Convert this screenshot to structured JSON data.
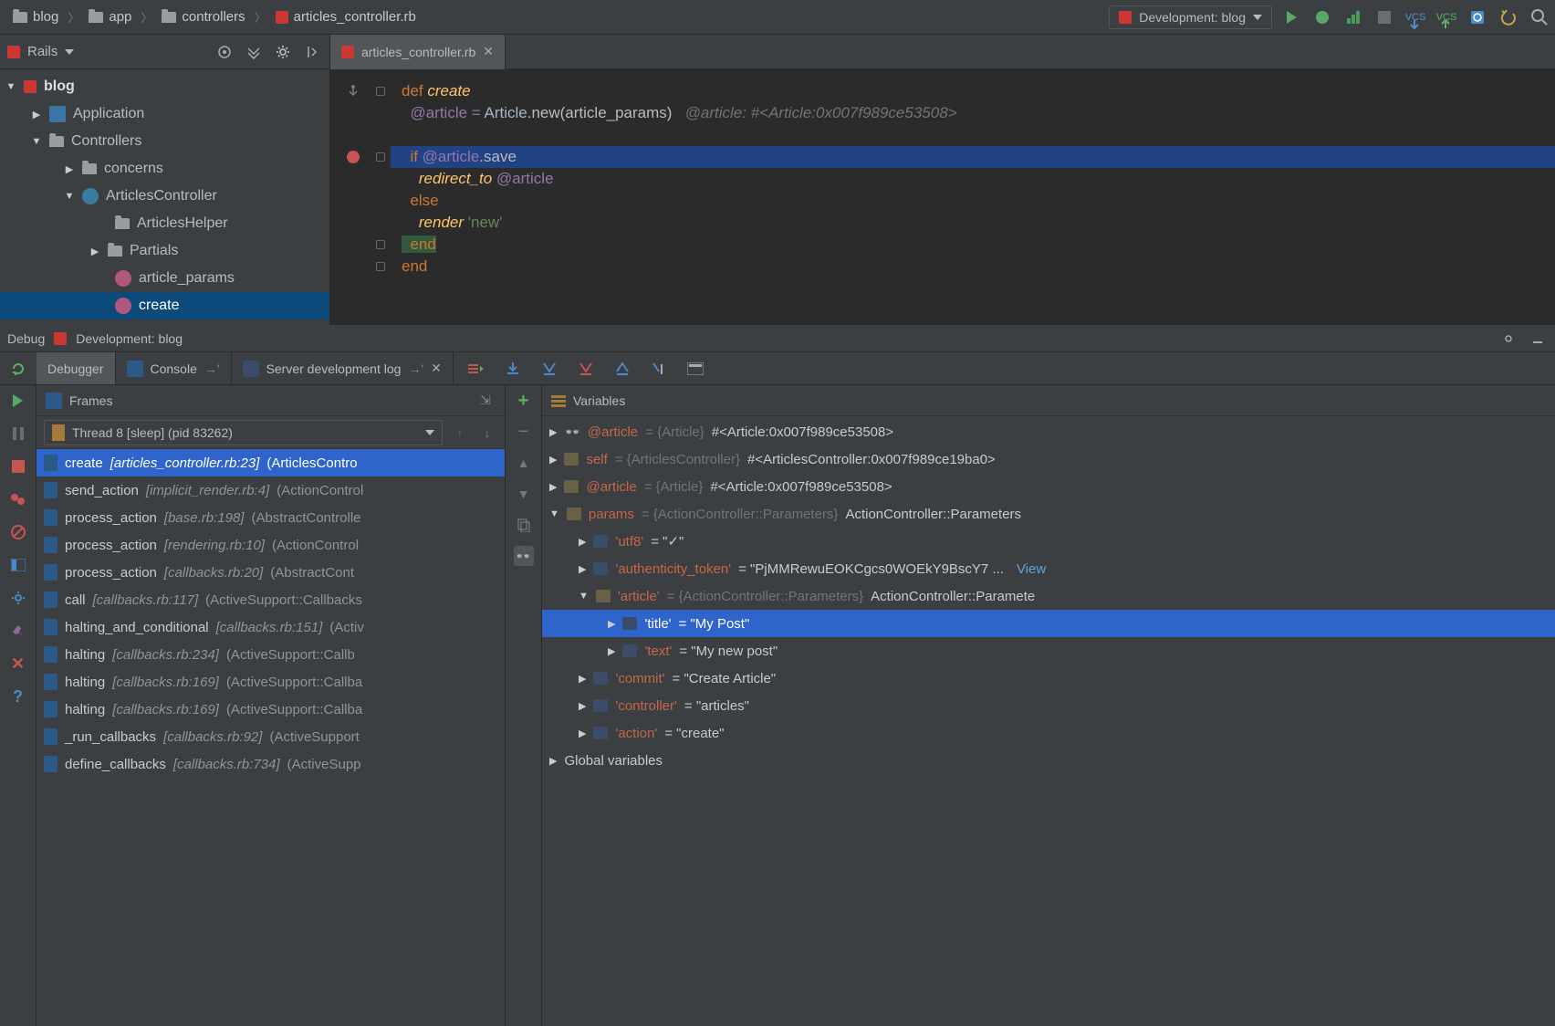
{
  "breadcrumbs": [
    "blog",
    "app",
    "controllers",
    "articles_controller.rb"
  ],
  "run_config": "Development: blog",
  "rails_dropdown": "Rails",
  "tab": {
    "name": "articles_controller.rb"
  },
  "tree": {
    "root": "blog",
    "application": "Application",
    "controllers": "Controllers",
    "concerns": "concerns",
    "articles_controller": "ArticlesController",
    "articles_helper": "ArticlesHelper",
    "partials": "Partials",
    "article_params": "article_params",
    "create": "create"
  },
  "code": {
    "l1": "def create",
    "l2_a": "  @article = ",
    "l2_b": "Article",
    "l2_c": ".new(article_params)",
    "l2_hint": "@article: #<Article:0x007f989ce53508>",
    "l4": "  if @article.save",
    "l5": "    redirect_to @article",
    "l6": "  else",
    "l7a": "    render ",
    "l7b": "'new'",
    "l8": "  end",
    "l9": "end"
  },
  "debug": {
    "label": "Debug",
    "config": "Development: blog",
    "tabs": {
      "debugger": "Debugger",
      "console": "Console",
      "log": "Server development log"
    },
    "frames_label": "Frames",
    "variables_label": "Variables",
    "thread": "Thread 8 [sleep] (pid 83262)",
    "frames": [
      {
        "m": "create",
        "loc": "[articles_controller.rb:23]",
        "cls": "(ArticlesContro"
      },
      {
        "m": "send_action",
        "loc": "[implicit_render.rb:4]",
        "cls": "(ActionControl"
      },
      {
        "m": "process_action",
        "loc": "[base.rb:198]",
        "cls": "(AbstractControlle"
      },
      {
        "m": "process_action",
        "loc": "[rendering.rb:10]",
        "cls": "(ActionControl"
      },
      {
        "m": "process_action",
        "loc": "[callbacks.rb:20]",
        "cls": "(AbstractCont"
      },
      {
        "m": "call",
        "loc": "[callbacks.rb:117]",
        "cls": "(ActiveSupport::Callbacks"
      },
      {
        "m": "halting_and_conditional",
        "loc": "[callbacks.rb:151]",
        "cls": "(Activ"
      },
      {
        "m": "halting",
        "loc": "[callbacks.rb:234]",
        "cls": "(ActiveSupport::Callb"
      },
      {
        "m": "halting",
        "loc": "[callbacks.rb:169]",
        "cls": "(ActiveSupport::Callba"
      },
      {
        "m": "halting",
        "loc": "[callbacks.rb:169]",
        "cls": "(ActiveSupport::Callba"
      },
      {
        "m": "_run_callbacks",
        "loc": "[callbacks.rb:92]",
        "cls": "(ActiveSupport"
      },
      {
        "m": "define_callbacks",
        "loc": "[callbacks.rb:734]",
        "cls": "(ActiveSupp"
      }
    ],
    "vars": {
      "article1": {
        "n": "@article",
        "t": "= {Article}",
        "v": "#<Article:0x007f989ce53508>"
      },
      "self": {
        "n": "self",
        "t": "= {ArticlesController}",
        "v": "#<ArticlesController:0x007f989ce19ba0>"
      },
      "article2": {
        "n": "@article",
        "t": "= {Article}",
        "v": "#<Article:0x007f989ce53508>"
      },
      "params": {
        "n": "params",
        "t": "= {ActionController::Parameters}",
        "v": "ActionController::Parameters"
      },
      "utf8": {
        "n": "'utf8'",
        "v": "= \"✓\""
      },
      "auth": {
        "n": "'authenticity_token'",
        "v": "= \"PjMMRewuEOKCgcs0WOEkY9BscY7 ...",
        "view": "View"
      },
      "art": {
        "n": "'article'",
        "t": "= {ActionController::Parameters}",
        "v": "ActionController::Paramete"
      },
      "title": {
        "n": "'title'",
        "v": "= \"My Post\""
      },
      "text": {
        "n": "'text'",
        "v": "= \"My new post\""
      },
      "commit": {
        "n": "'commit'",
        "v": "= \"Create Article\""
      },
      "ctrl": {
        "n": "'controller'",
        "v": "= \"articles\""
      },
      "action": {
        "n": "'action'",
        "v": "= \"create\""
      },
      "global": "Global variables"
    }
  }
}
